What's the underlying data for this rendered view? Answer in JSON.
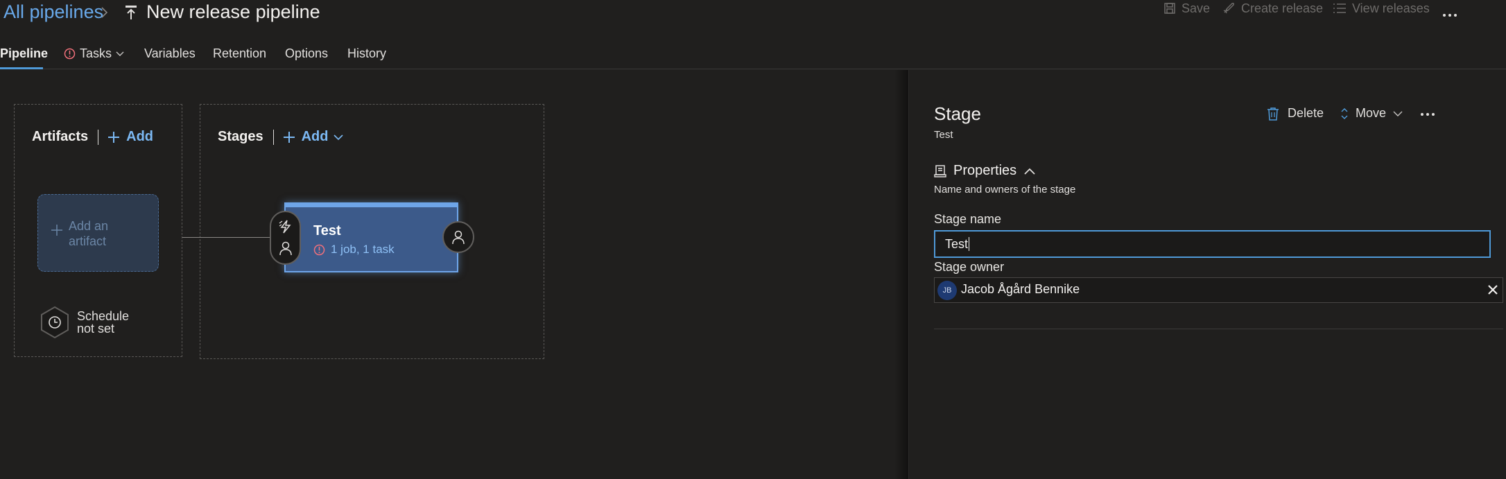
{
  "header": {
    "breadcrumb_root": "All pipelines",
    "title": "New release pipeline",
    "toolbar": {
      "save_label": "Save",
      "create_release_label": "Create release",
      "view_releases_label": "View releases"
    }
  },
  "tabs": [
    {
      "label": "Pipeline",
      "active": true
    },
    {
      "label": "Tasks",
      "has_error": true,
      "has_dropdown": true
    },
    {
      "label": "Variables"
    },
    {
      "label": "Retention"
    },
    {
      "label": "Options"
    },
    {
      "label": "History"
    }
  ],
  "canvas": {
    "artifacts": {
      "title": "Artifacts",
      "add_label": "Add",
      "placeholder_card": "Add an artifact",
      "schedule_label": "Schedule not set"
    },
    "stages": {
      "title": "Stages",
      "add_label": "Add",
      "stage": {
        "name": "Test",
        "status": "1 job, 1 task"
      }
    }
  },
  "panel": {
    "title": "Stage",
    "subtitle": "Test",
    "delete_label": "Delete",
    "move_label": "Move",
    "properties": {
      "heading": "Properties",
      "description": "Name and owners of the stage"
    },
    "fields": {
      "stage_name_label": "Stage name",
      "stage_name_value": "Test",
      "stage_owner_label": "Stage owner",
      "owner_initials": "JB",
      "owner_name": "Jacob Ågård Bennike"
    }
  },
  "colors": {
    "accent": "#4f9ad8",
    "link": "#69a9ea",
    "error": "#f1707b",
    "stage_card": "#3c5a8a"
  }
}
